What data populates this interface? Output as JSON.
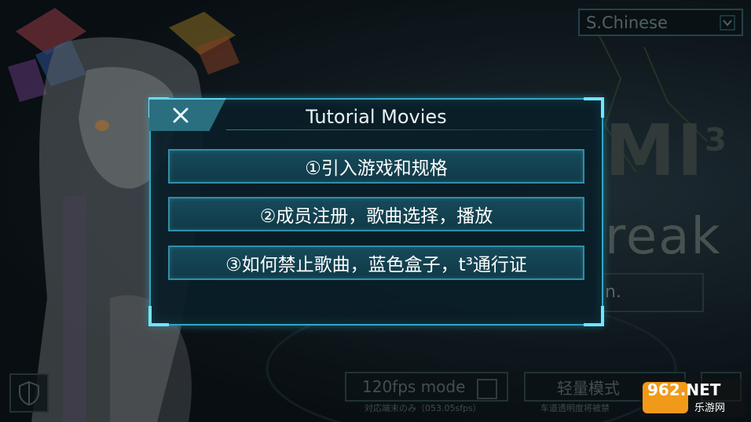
{
  "language_selector": {
    "value": "S.Chinese"
  },
  "background": {
    "logo_fragment": "MI",
    "logo_superscript": "3",
    "logo_subtitle_fragment": "reak",
    "input_fragment": "n."
  },
  "dialog": {
    "title": "Tutorial Movies",
    "items": [
      {
        "label": "①引入游戏和规格"
      },
      {
        "label": "②成员注册，歌曲选择，播放"
      },
      {
        "label": "③如何禁止歌曲，蓝色盒子，t³通行证"
      }
    ]
  },
  "bottom": {
    "fps_label": "120fps mode",
    "fps_sub": "対応端末のみ（053.05sfps）",
    "light_label": "轻量模式",
    "light_sub": "车道透明度将被禁"
  },
  "watermark": {
    "brand": "962.NET",
    "sub": "乐游网"
  },
  "colors": {
    "accent": "#2fa7c2",
    "accent_light": "#6ee7ff",
    "dialog_bg": "#0a1e28",
    "item_bg": "#164a5a",
    "text": "#ffffff"
  },
  "icons": [
    "close-icon",
    "chevron-down-icon",
    "shield-icon",
    "checkbox-icon"
  ]
}
